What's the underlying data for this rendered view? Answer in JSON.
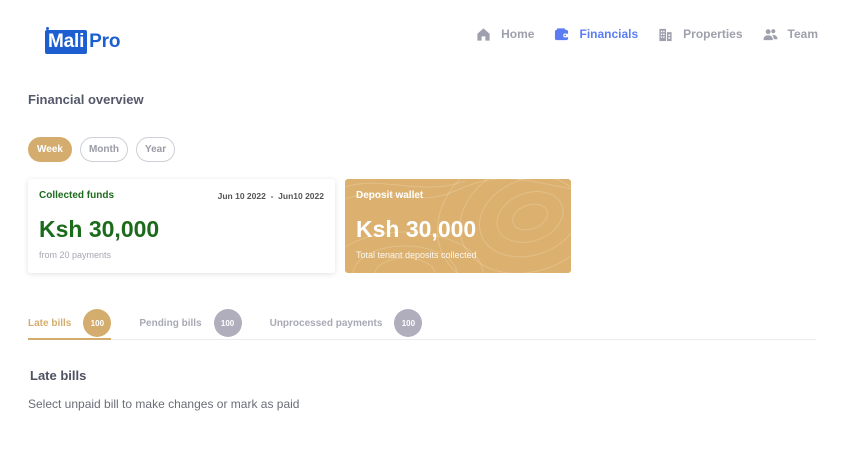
{
  "logo": {
    "part1": "Mali",
    "part2": "Pro"
  },
  "nav": [
    {
      "label": "Home",
      "icon": "home-icon",
      "active": false
    },
    {
      "label": "Financials",
      "icon": "wallet-icon",
      "active": true
    },
    {
      "label": "Properties",
      "icon": "building-icon",
      "active": false
    },
    {
      "label": "Team",
      "icon": "team-icon",
      "active": false
    }
  ],
  "page_title": "Financial overview",
  "period": {
    "options": [
      "Week",
      "Month",
      "Year"
    ],
    "selected": "Week"
  },
  "cards": {
    "collected": {
      "label": "Collected funds",
      "date_from": "Jun 10 2022",
      "date_separator": "-",
      "date_to": "Jun10 2022",
      "amount": "Ksh 30,000",
      "sub": "from 20 payments"
    },
    "deposit": {
      "label": "Deposit wallet",
      "amount": "Ksh 30,000",
      "sub": "Total tenant deposits collected"
    }
  },
  "tabs": [
    {
      "label": "Late bills",
      "count": "100",
      "active": true
    },
    {
      "label": "Pending bills",
      "count": "100",
      "active": false
    },
    {
      "label": "Unprocessed payments",
      "count": "100",
      "active": false
    }
  ],
  "section": {
    "title": "Late bills",
    "description": "Select unpaid bill to make changes or mark as paid"
  },
  "colors": {
    "accent_gold": "#d4ad6e",
    "nav_active": "#5b7df2",
    "brand_blue": "#1d5fd0",
    "money_green": "#1c6b1c",
    "badge_grey": "#b0adbd"
  }
}
